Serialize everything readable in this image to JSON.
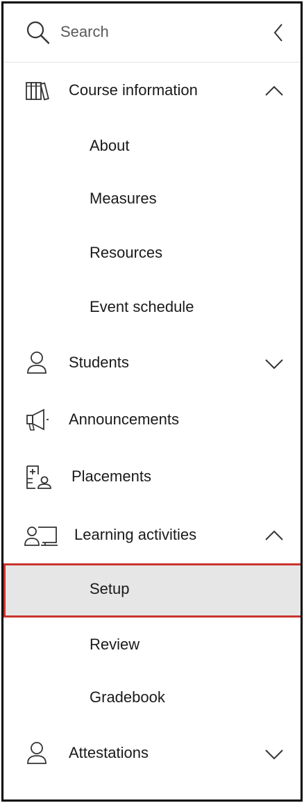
{
  "search": {
    "placeholder": "Search",
    "icon": "search-icon",
    "collapse_icon": "chevron-left-icon"
  },
  "nav": {
    "course_information": {
      "label": "Course information",
      "icon": "books-icon",
      "expanded": true,
      "children": [
        "About",
        "Measures",
        "Resources",
        "Event schedule"
      ]
    },
    "students": {
      "label": "Students",
      "icon": "person-icon",
      "expanded": false
    },
    "announcements": {
      "label": "Announcements",
      "icon": "megaphone-icon"
    },
    "placements": {
      "label": "Placements",
      "icon": "placements-icon"
    },
    "learning_activities": {
      "label": "Learning activities",
      "icon": "presenter-board-icon",
      "expanded": true,
      "children": [
        "Setup",
        "Review",
        "Gradebook"
      ],
      "active_child": "Setup"
    },
    "attestations": {
      "label": "Attestations",
      "icon": "person-icon",
      "expanded": false
    }
  },
  "colors": {
    "active_background": "#e6e6e6",
    "active_outline": "#c9342c",
    "active_left_bar": "#3a4bd9",
    "frame_border": "#000000"
  }
}
